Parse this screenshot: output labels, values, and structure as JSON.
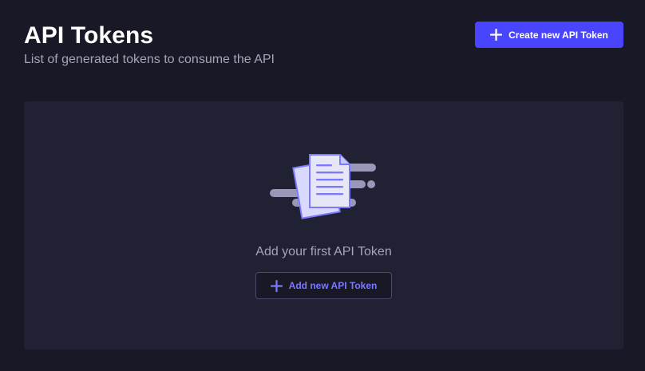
{
  "header": {
    "title": "API Tokens",
    "subtitle": "List of generated tokens to consume the API",
    "create_button_label": "Create new API Token"
  },
  "empty_state": {
    "message": "Add your first API Token",
    "add_button_label": "Add new API Token",
    "illustration_icon": "documents-icon"
  },
  "icons": {
    "create_button_icon": "plus-icon",
    "add_button_icon": "plus-icon"
  },
  "colors": {
    "background": "#181826",
    "panel": "#212134",
    "primary": "#4945ff",
    "primary_text": "#7b79ff",
    "muted_text": "#a5a5ba"
  }
}
